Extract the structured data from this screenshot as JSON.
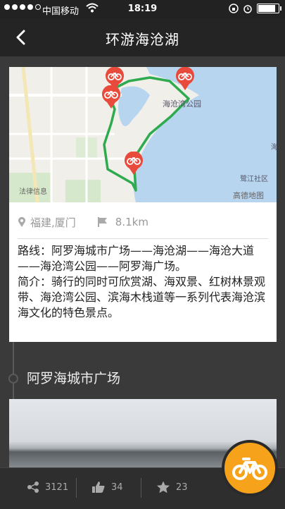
{
  "status_bar": {
    "carrier": "中国移动",
    "time": "18:19",
    "battery_level": 0.85
  },
  "nav": {
    "title": "环游海沧湖"
  },
  "map": {
    "labels": {
      "park": "海沧湾公园",
      "district": "鹭江社区",
      "legal": "法律信息",
      "brand": "高德地图",
      "edge": "海"
    },
    "colors": {
      "route": "#2eaa4f",
      "marker": "#e84b3c",
      "water": "#b8d5f0"
    }
  },
  "route": {
    "location": "福建,厦门",
    "distance": "8.1km"
  },
  "description": {
    "route": "路线：阿罗海城市广场——海沧湖——海沧大道——海沧湾公园——阿罗海广场。",
    "intro": "简介：骑行的同时可欣赏湖、海双景、红树林景观带、海沧湾公园、滨海木栈道等一系列代表海沧滨海文化的特色景点。"
  },
  "stop": {
    "title": "阿罗海城市广场"
  },
  "bottom_bar": {
    "shares": "3121",
    "likes": "34",
    "favorites": "23"
  },
  "accent_color": "#f7a21b"
}
